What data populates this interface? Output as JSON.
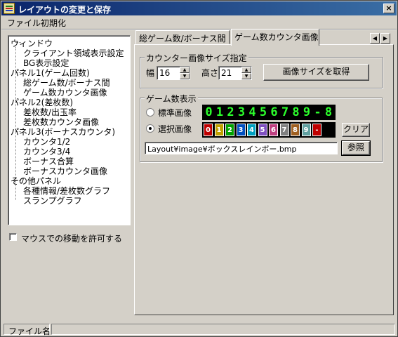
{
  "window": {
    "title": "レイアウトの変更と保存",
    "close_glyph": "×"
  },
  "menu": {
    "file": "ファイル",
    "init": "初期化"
  },
  "tree": {
    "nodes": [
      "ウィンドウ",
      "クライアント領域表示設定",
      "BG表示設定",
      "パネル1(ゲーム回数)",
      "総ゲーム数/ボーナス間",
      "ゲーム数カウンタ画像",
      "パネル2(差枚数)",
      "差枚数/出玉率",
      "差枚数カウンタ画像",
      "パネル3(ボーナスカウンタ)",
      "カウンタ1/2",
      "カウンタ3/4",
      "ボーナス合算",
      "ボーナスカウンタ画像",
      "その他パネル",
      "各種情報/差枚数グラフ",
      "スランプグラフ"
    ]
  },
  "checkbox": {
    "label": "マウスでの移動を許可する",
    "checked": false
  },
  "tabs": [
    "総ゲーム数/ボーナス間",
    "ゲーム数カウンタ画像"
  ],
  "tab_scroll": {
    "left": "◀",
    "right": "▶"
  },
  "size_group": {
    "title": "カウンター画像サイズ指定",
    "width_label": "幅",
    "width_value": "16",
    "height_label": "高さ",
    "height_value": "21",
    "get_size_button": "画像サイズを取得"
  },
  "game_group": {
    "title": "ゲーム数表示",
    "standard_label": "標準画像",
    "select_label": "選択画像",
    "selected_option": "選択画像",
    "standard_digits": [
      "0",
      "1",
      "2",
      "3",
      "4",
      "5",
      "6",
      "7",
      "8",
      "9",
      "-",
      "8"
    ],
    "select_digits": [
      "0",
      "1",
      "2",
      "3",
      "4",
      "5",
      "6",
      "7",
      "8",
      "9",
      "-"
    ],
    "digit_color": "#2cff2c",
    "select_colors": [
      "#c00000",
      "#c0a000",
      "#00a000",
      "#0050c0",
      "#00a0c0",
      "#8050c0",
      "#c04080",
      "#808080",
      "#a06020",
      "#60a0a0",
      "#c00000"
    ],
    "clear_button": "クリア",
    "path_value": "Layout¥image¥ボックスレインボー.bmp",
    "browse_button": "参照"
  },
  "status": {
    "label": "ファイル名"
  },
  "colors": {
    "title_start": "#0a246a",
    "title_end": "#3a6ea5",
    "face": "#d4d0c8"
  }
}
